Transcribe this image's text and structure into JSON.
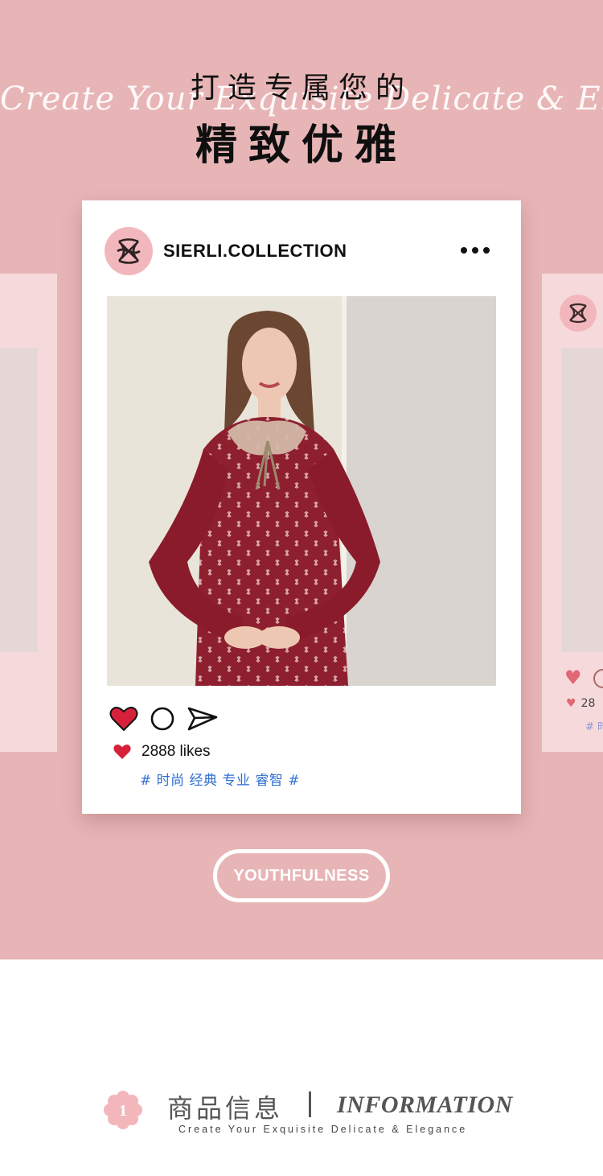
{
  "hero": {
    "script_text": "Create Your Exquisite Delicate & Elegance",
    "title_line1": "打造专属您的",
    "title_line2": "精致优雅"
  },
  "post": {
    "handle": "SIERLI.COLLECTION",
    "likes_text": "2888 likes",
    "hashtags": "# 时尚 经典 专业 睿智 #"
  },
  "side_card_right": {
    "likes_fragment": "28",
    "tag_fragment": "# 时"
  },
  "pill_label": "YOUTHFULNESS",
  "section": {
    "number": "1",
    "title_cn": "商品信息",
    "title_en": "INFORMATION",
    "subtitle": "Create Your Exquisite Delicate & Elegance"
  },
  "colors": {
    "hero_bg": "#e8b5b6",
    "card_bg": "#ffffff",
    "heart_red": "#d7213a",
    "tag_blue": "#2f6ed2",
    "dress_red": "#8e1f2e"
  },
  "icons": [
    "brand-logo-icon",
    "more-icon",
    "heart-icon",
    "comment-icon",
    "share-icon",
    "like-heart-icon",
    "flower-badge-icon"
  ]
}
